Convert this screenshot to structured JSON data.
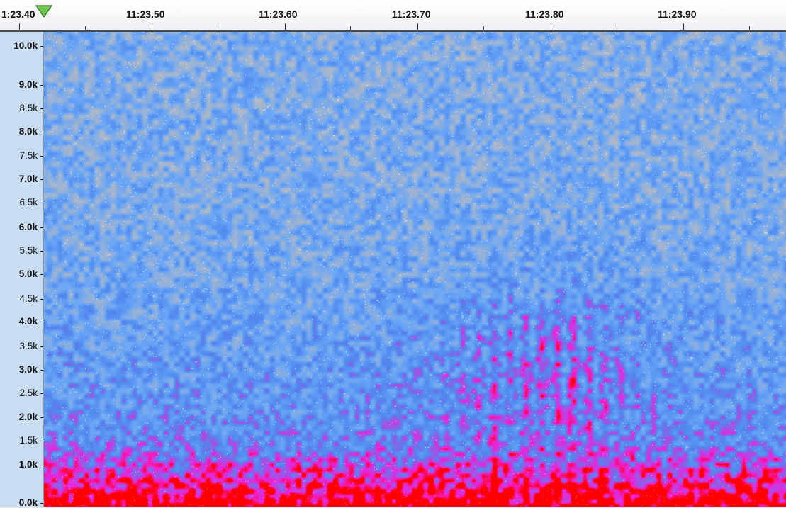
{
  "timeline": {
    "labels": [
      "1:23.40",
      "11:23.50",
      "11:23.60",
      "11:23.70",
      "11:23.80",
      "11:23.90"
    ]
  },
  "play_marker": {
    "color": "#6cc94a",
    "icon": "play-position-triangle-icon"
  },
  "frequency_ruler": {
    "labels": [
      "10.0k",
      "9.0k",
      "8.5k",
      "8.0k",
      "7.5k",
      "7.0k",
      "6.5k",
      "6.0k",
      "5.5k",
      "5.0k",
      "4.5k",
      "4.0k",
      "3.5k",
      "3.0k",
      "2.5k",
      "2.0k",
      "1.5k",
      "1.0k",
      "0.0k"
    ],
    "background": "#c8dcf2"
  },
  "spectrogram": {
    "colors": {
      "background": "#b4b9c3",
      "low": "#6aa6f6",
      "mid": "#4f88ee",
      "high": "#ee22dd",
      "peak": "#ff0000"
    }
  }
}
